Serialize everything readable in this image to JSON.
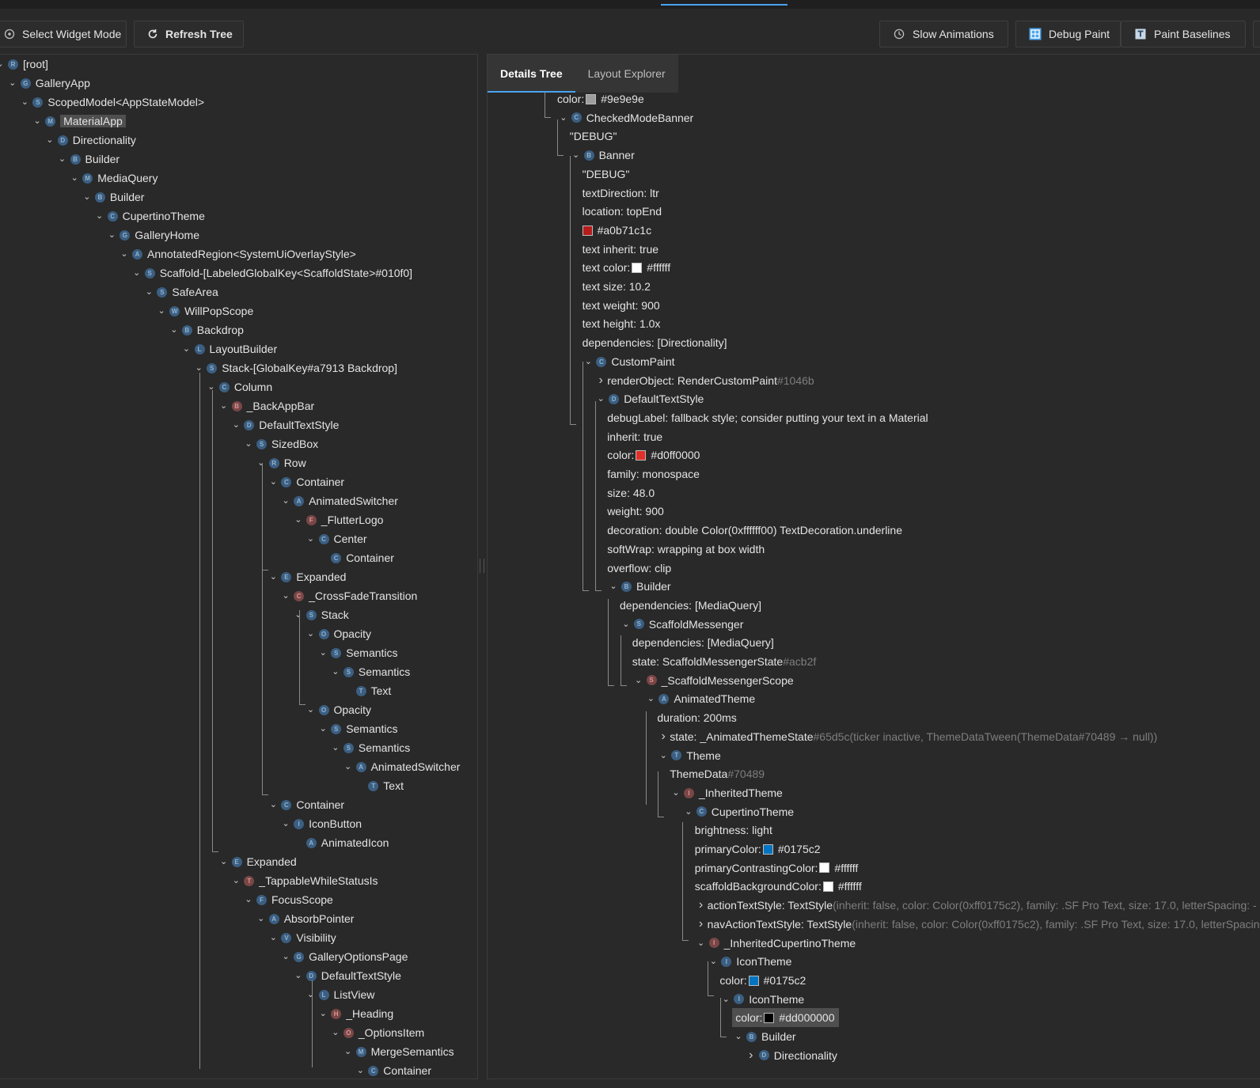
{
  "toolbar": {
    "select_widget_mode": "Select Widget Mode",
    "refresh_tree": "Refresh Tree",
    "slow_animations": "Slow Animations",
    "debug_paint": "Debug Paint",
    "paint_baselines": "Paint Baselines"
  },
  "tabs": [
    "Details Tree",
    "Layout Explorer"
  ],
  "widget_tree": [
    {
      "label": "[root]",
      "badge": "R",
      "depth": 0
    },
    {
      "label": "GalleryApp",
      "badge": "G",
      "depth": 1
    },
    {
      "label": "ScopedModel<AppStateModel>",
      "badge": "S",
      "depth": 2
    },
    {
      "label": "MaterialApp",
      "badge": "M",
      "depth": 3,
      "selected": true
    },
    {
      "label": "Directionality",
      "badge": "D",
      "depth": 4
    },
    {
      "label": "Builder",
      "badge": "B",
      "depth": 5
    },
    {
      "label": "MediaQuery",
      "badge": "M",
      "depth": 6
    },
    {
      "label": "Builder",
      "badge": "B",
      "depth": 7
    },
    {
      "label": "CupertinoTheme",
      "badge": "C",
      "depth": 8
    },
    {
      "label": "GalleryHome",
      "badge": "G",
      "depth": 9
    },
    {
      "label": "AnnotatedRegion<SystemUiOverlayStyle>",
      "badge": "A",
      "depth": 10
    },
    {
      "label": "Scaffold-[LabeledGlobalKey<ScaffoldState>#010f0]",
      "badge": "S",
      "depth": 11
    },
    {
      "label": "SafeArea",
      "badge": "S",
      "depth": 12
    },
    {
      "label": "WillPopScope",
      "badge": "W",
      "depth": 13
    },
    {
      "label": "Backdrop",
      "badge": "B",
      "depth": 14
    },
    {
      "label": "LayoutBuilder",
      "badge": "L",
      "depth": 15
    },
    {
      "label": "Stack-[GlobalKey#a7913 Backdrop]",
      "badge": "S",
      "depth": 16
    },
    {
      "label": "Column",
      "badge": "C",
      "depth": 17
    },
    {
      "label": "_BackAppBar",
      "badge": "B",
      "depth": 18,
      "red": true
    },
    {
      "label": "DefaultTextStyle",
      "badge": "D",
      "depth": 19
    },
    {
      "label": "SizedBox",
      "badge": "S",
      "depth": 20
    },
    {
      "label": "Row",
      "badge": "R",
      "depth": 21
    },
    {
      "label": "Container",
      "badge": "C",
      "depth": 22
    },
    {
      "label": "AnimatedSwitcher",
      "badge": "A",
      "depth": 23
    },
    {
      "label": "_FlutterLogo",
      "badge": "F",
      "depth": 24,
      "red": true
    },
    {
      "label": "Center",
      "badge": "C",
      "depth": 25
    },
    {
      "label": "Container",
      "badge": "C",
      "depth": 26,
      "leaf": true
    },
    {
      "label": "Expanded",
      "badge": "E",
      "depth": 22
    },
    {
      "label": "_CrossFadeTransition",
      "badge": "C",
      "depth": 23,
      "red": true
    },
    {
      "label": "Stack",
      "badge": "S",
      "depth": 24
    },
    {
      "label": "Opacity",
      "badge": "O",
      "depth": 25
    },
    {
      "label": "Semantics",
      "badge": "S",
      "depth": 26
    },
    {
      "label": "Semantics",
      "badge": "S",
      "depth": 27
    },
    {
      "label": "Text",
      "badge": "T",
      "depth": 28,
      "leaf": true
    },
    {
      "label": "Opacity",
      "badge": "O",
      "depth": 25
    },
    {
      "label": "Semantics",
      "badge": "S",
      "depth": 26
    },
    {
      "label": "Semantics",
      "badge": "S",
      "depth": 27
    },
    {
      "label": "AnimatedSwitcher",
      "badge": "A",
      "depth": 28
    },
    {
      "label": "Text",
      "badge": "T",
      "depth": 29,
      "leaf": true
    },
    {
      "label": "Container",
      "badge": "C",
      "depth": 22
    },
    {
      "label": "IconButton",
      "badge": "I",
      "depth": 23
    },
    {
      "label": "AnimatedIcon",
      "badge": "A",
      "depth": 24,
      "leaf": true
    },
    {
      "label": "Expanded",
      "badge": "E",
      "depth": 18
    },
    {
      "label": "_TappableWhileStatusIs",
      "badge": "T",
      "depth": 19,
      "red": true
    },
    {
      "label": "FocusScope",
      "badge": "F",
      "depth": 20
    },
    {
      "label": "AbsorbPointer",
      "badge": "A",
      "depth": 21
    },
    {
      "label": "Visibility",
      "badge": "V",
      "depth": 22
    },
    {
      "label": "GalleryOptionsPage",
      "badge": "G",
      "depth": 23
    },
    {
      "label": "DefaultTextStyle",
      "badge": "D",
      "depth": 24
    },
    {
      "label": "ListView",
      "badge": "L",
      "depth": 25
    },
    {
      "label": "_Heading",
      "badge": "H",
      "depth": 26,
      "red": true
    },
    {
      "label": "_OptionsItem",
      "badge": "O",
      "depth": 27,
      "red": true
    },
    {
      "label": "MergeSemantics",
      "badge": "M",
      "depth": 28
    },
    {
      "label": "Container",
      "badge": "C",
      "depth": 29
    }
  ],
  "details_tree": [
    {
      "text": "color:",
      "swatch": "#9e9e9e",
      "value": "#9e9e9e",
      "depth": 0,
      "prop": true
    },
    {
      "text": "CheckedModeBanner",
      "badge": "C",
      "depth": 1
    },
    {
      "text": "\"DEBUG\"",
      "depth": 1,
      "prop": true
    },
    {
      "text": "Banner",
      "badge": "B",
      "depth": 2
    },
    {
      "text": "\"DEBUG\"",
      "depth": 2,
      "prop": true
    },
    {
      "text": "textDirection: ltr",
      "depth": 2,
      "prop": true
    },
    {
      "text": "location: topEnd",
      "depth": 2,
      "prop": true
    },
    {
      "text": "",
      "swatch": "#a0b71c1c",
      "swatchColor": "#b71c1c",
      "value": "#a0b71c1c",
      "depth": 2,
      "prop": true
    },
    {
      "text": "text inherit: true",
      "depth": 2,
      "prop": true
    },
    {
      "text": "text color:",
      "swatch": "#ffffff",
      "value": "#ffffff",
      "depth": 2,
      "prop": true
    },
    {
      "text": "text size: 10.2",
      "depth": 2,
      "prop": true
    },
    {
      "text": "text weight: 900",
      "depth": 2,
      "prop": true
    },
    {
      "text": "text height: 1.0x",
      "depth": 2,
      "prop": true
    },
    {
      "text": "dependencies: [Directionality]",
      "depth": 2,
      "prop": true
    },
    {
      "text": "CustomPaint",
      "badge": "C",
      "depth": 3
    },
    {
      "text": "renderObject: RenderCustomPaint",
      "dim": "#1046b",
      "depth": 4,
      "collapsed": true
    },
    {
      "text": "DefaultTextStyle",
      "badge": "D",
      "depth": 4
    },
    {
      "text": "debugLabel: fallback style; consider putting your text in a Material",
      "depth": 4,
      "prop": true
    },
    {
      "text": "inherit: true",
      "depth": 4,
      "prop": true
    },
    {
      "text": "color:",
      "swatch": "#d0ff0000",
      "swatchColor": "#e0302a",
      "value": "#d0ff0000",
      "depth": 4,
      "prop": true
    },
    {
      "text": "family: monospace",
      "depth": 4,
      "prop": true
    },
    {
      "text": "size: 48.0",
      "depth": 4,
      "prop": true
    },
    {
      "text": "weight: 900",
      "depth": 4,
      "prop": true
    },
    {
      "text": "decoration: double Color(0xffffff00) TextDecoration.underline",
      "depth": 4,
      "prop": true
    },
    {
      "text": "softWrap: wrapping at box width",
      "depth": 4,
      "prop": true
    },
    {
      "text": "overflow: clip",
      "depth": 4,
      "prop": true
    },
    {
      "text": "Builder",
      "badge": "B",
      "depth": 5
    },
    {
      "text": "dependencies: [MediaQuery]",
      "depth": 5,
      "prop": true
    },
    {
      "text": "ScaffoldMessenger",
      "badge": "S",
      "depth": 6
    },
    {
      "text": "dependencies: [MediaQuery]",
      "depth": 6,
      "prop": true
    },
    {
      "text": "state: ScaffoldMessengerState",
      "dim": "#acb2f",
      "depth": 6,
      "prop": true
    },
    {
      "text": "_ScaffoldMessengerScope",
      "badge": "S",
      "depth": 7,
      "red": true
    },
    {
      "text": "AnimatedTheme",
      "badge": "A",
      "depth": 8
    },
    {
      "text": "duration: 200ms",
      "depth": 8,
      "prop": true
    },
    {
      "text": "state: _AnimatedThemeState",
      "dim": "#65d5c(ticker inactive, ThemeDataTween(ThemeData#70489 → null))",
      "depth": 9,
      "collapsed": true
    },
    {
      "text": "Theme",
      "badge": "T",
      "depth": 9
    },
    {
      "text": "ThemeData",
      "dim": "#70489",
      "depth": 9,
      "prop": true
    },
    {
      "text": "_InheritedTheme",
      "badge": "I",
      "depth": 10,
      "red": true
    },
    {
      "text": "CupertinoTheme",
      "badge": "C",
      "depth": 11
    },
    {
      "text": "brightness: light",
      "depth": 11,
      "prop": true
    },
    {
      "text": "primaryColor:",
      "swatch": "#0175c2",
      "value": "#0175c2",
      "depth": 11,
      "prop": true
    },
    {
      "text": "primaryContrastingColor:",
      "swatch": "#ffffff",
      "value": "#ffffff",
      "depth": 11,
      "prop": true
    },
    {
      "text": "scaffoldBackgroundColor:",
      "swatch": "#ffffff",
      "value": "#ffffff",
      "depth": 11,
      "prop": true
    },
    {
      "text": "actionTextStyle: TextStyle",
      "dim": "(inherit: false, color: Color(0xff0175c2), family: .SF Pro Text, size: 17.0, letterSpacing: -",
      "depth": 12,
      "collapsed": true
    },
    {
      "text": "navActionTextStyle: TextStyle",
      "dim": "(inherit: false, color: Color(0xff0175c2), family: .SF Pro Text, size: 17.0, letterSpacin",
      "depth": 12,
      "collapsed": true
    },
    {
      "text": "_InheritedCupertinoTheme",
      "badge": "I",
      "depth": 12,
      "red": true
    },
    {
      "text": "IconTheme",
      "badge": "I",
      "depth": 13
    },
    {
      "text": "color:",
      "swatch": "#0175c2",
      "value": "#0175c2",
      "depth": 13,
      "prop": true
    },
    {
      "text": "IconTheme",
      "badge": "I",
      "depth": 14
    },
    {
      "text": "color:",
      "swatch": "#dd000000",
      "swatchColor": "#000000",
      "value": "#dd000000",
      "depth": 14,
      "prop": true,
      "hilite": true
    },
    {
      "text": "Builder",
      "badge": "B",
      "depth": 15
    },
    {
      "text": "Directionality",
      "badge": "D",
      "depth": 16,
      "collapsed": true
    }
  ]
}
